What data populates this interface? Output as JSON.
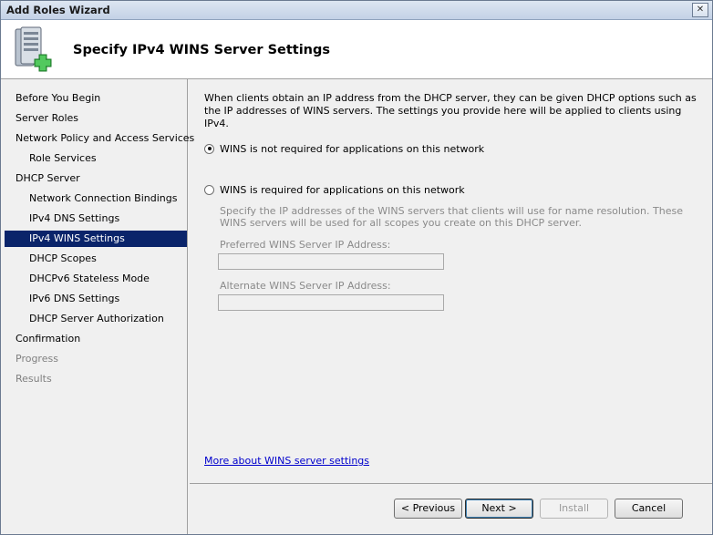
{
  "window": {
    "title": "Add Roles Wizard",
    "close_glyph": "✕"
  },
  "header": {
    "title": "Specify IPv4 WINS Server Settings",
    "icon": "server-add-icon"
  },
  "nav": {
    "items": [
      {
        "label": "Before You Begin",
        "state": "normal"
      },
      {
        "label": "Server Roles",
        "state": "normal"
      },
      {
        "label": "Network Policy and Access Services",
        "state": "normal"
      },
      {
        "label": "Role Services",
        "state": "normal"
      },
      {
        "label": "DHCP Server",
        "state": "normal"
      },
      {
        "label": "Network Connection Bindings",
        "state": "normal"
      },
      {
        "label": "IPv4 DNS Settings",
        "state": "normal"
      },
      {
        "label": "IPv4 WINS Settings",
        "state": "selected"
      },
      {
        "label": "DHCP Scopes",
        "state": "normal"
      },
      {
        "label": "DHCPv6 Stateless Mode",
        "state": "normal"
      },
      {
        "label": "IPv6 DNS Settings",
        "state": "normal"
      },
      {
        "label": "DHCP Server Authorization",
        "state": "normal"
      },
      {
        "label": "Confirmation",
        "state": "normal"
      },
      {
        "label": "Progress",
        "state": "disabled"
      },
      {
        "label": "Results",
        "state": "disabled"
      }
    ]
  },
  "content": {
    "description": "When clients obtain an IP address from the DHCP server, they can be given DHCP options such as the IP addresses of WINS servers. The settings you provide here will be applied to clients using IPv4.",
    "option_not_required": "WINS is not required for applications on this network",
    "option_required": "WINS is required for applications on this network",
    "selected_option": "not_required",
    "required_description": "Specify the IP addresses of the WINS servers that clients will use for name resolution. These WINS servers will be used for all scopes you create on this DHCP server.",
    "preferred_label": "Preferred WINS Server IP Address:",
    "preferred_value": "",
    "alternate_label": "Alternate WINS Server IP Address:",
    "alternate_value": "",
    "more_link": "More about WINS server settings"
  },
  "footer": {
    "previous": "< Previous",
    "next": "Next >",
    "install": "Install",
    "cancel": "Cancel"
  },
  "colors": {
    "selection": "#0a246a",
    "link": "#0000cc"
  }
}
